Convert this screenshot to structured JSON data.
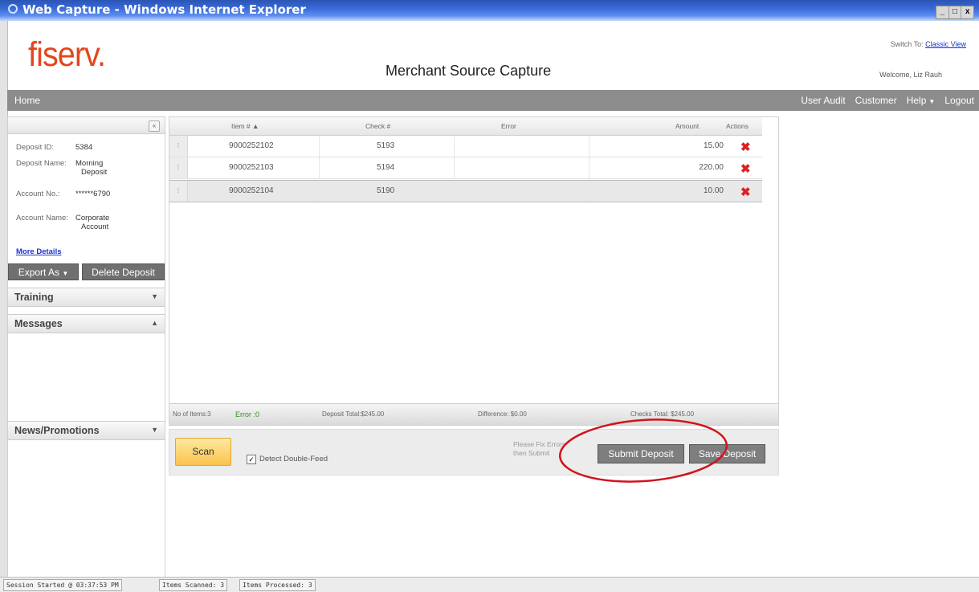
{
  "window": {
    "title": "Web Capture - Windows Internet Explorer",
    "controls": [
      "_",
      "□",
      "x"
    ]
  },
  "header": {
    "logo": "fiserv.",
    "app_title": "Merchant Source Capture",
    "switch_label": "Switch To:",
    "switch_link": "Classic View",
    "welcome": "Welcome, Liz Rauh"
  },
  "nav": {
    "home": "Home",
    "items": [
      "User Audit",
      "Customer",
      "Help",
      "Logout"
    ]
  },
  "sidebar": {
    "collapse_icon": "«",
    "deposit_id_label": "Deposit ID:",
    "deposit_id": "5384",
    "deposit_name_label": "Deposit Name:",
    "deposit_name_1": "Morning",
    "deposit_name_2": "Deposit",
    "account_no_label": "Account No.:",
    "account_no": "******6790",
    "account_name_label": "Account Name:",
    "account_name_1": "Corporate",
    "account_name_2": "Account",
    "more_details": "More Details",
    "export_label": "Export As",
    "delete_label": "Delete Deposit",
    "training": "Training",
    "messages": "Messages",
    "news": "News/Promotions"
  },
  "grid": {
    "columns": {
      "item": "Item # ▲",
      "check": "Check #",
      "error": "Error",
      "amount": "Amount",
      "actions": "Actions"
    },
    "rows": [
      {
        "handle": "⁞",
        "item": "9000252102",
        "check": "5193",
        "error": "",
        "amount": "15.00"
      },
      {
        "handle": "⁞",
        "item": "9000252103",
        "check": "5194",
        "error": "",
        "amount": "220.00"
      },
      {
        "handle": "⁞",
        "item": "9000252104",
        "check": "5190",
        "error": "",
        "amount": "10.00"
      }
    ],
    "footer": {
      "items": "No of Items:3",
      "error": "Error :0",
      "deposit_total": "Deposit Total:$245.00",
      "difference": "Difference: $0.00",
      "checks_total": "Checks Total: $245.00"
    }
  },
  "actions": {
    "scan": "Scan",
    "detect_double_feed": "Detect Double-Feed",
    "fix_msg_1": "Please Fix Errors",
    "fix_msg_2": "then Submit",
    "submit": "Submit Deposit",
    "save": "Save Deposit"
  },
  "status": {
    "session": "Session Started @ 03:37:53 PM",
    "scanned": "Items Scanned: 3",
    "processed": "Items Processed: 3"
  },
  "colors": {
    "logo": "#e3461e",
    "nav": "#8c8c8c",
    "delete_icon": "#e02020",
    "annotation": "#d0141c"
  }
}
